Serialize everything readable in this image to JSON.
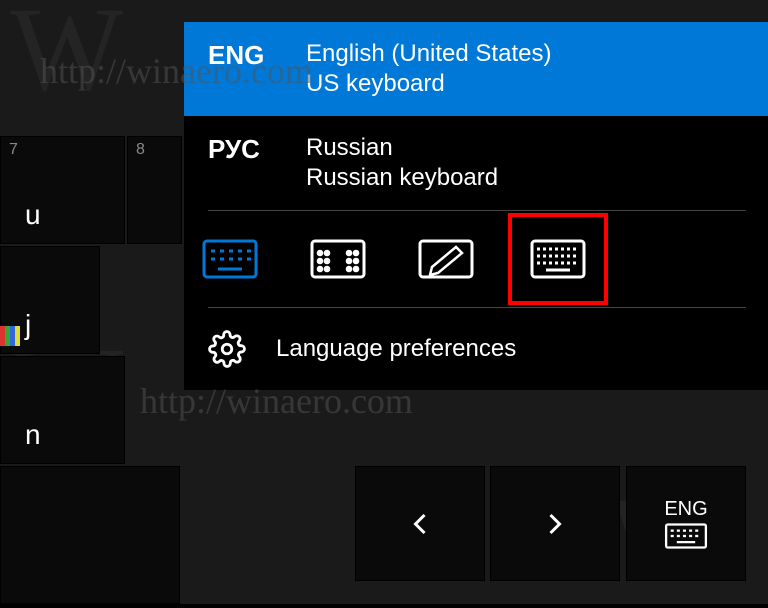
{
  "keys": {
    "u": {
      "num": "7",
      "letter": "u"
    },
    "i_num": "8",
    "j": {
      "letter": "j"
    },
    "n": {
      "letter": "n"
    }
  },
  "taskbar_indicator": {
    "label": "ENG"
  },
  "popup": {
    "languages": [
      {
        "code": "ENG",
        "name": "English (United States)",
        "layout": "US keyboard",
        "selected": true
      },
      {
        "code": "РУС",
        "name": "Russian",
        "layout": "Russian keyboard",
        "selected": false
      }
    ],
    "preferences_label": "Language preferences"
  },
  "watermark": {
    "url1": "http://winaero.com",
    "url2": "http://winaero.com",
    "w": "W"
  },
  "colors": {
    "accent": "#0078d7",
    "highlight_box": "#ff0000"
  }
}
